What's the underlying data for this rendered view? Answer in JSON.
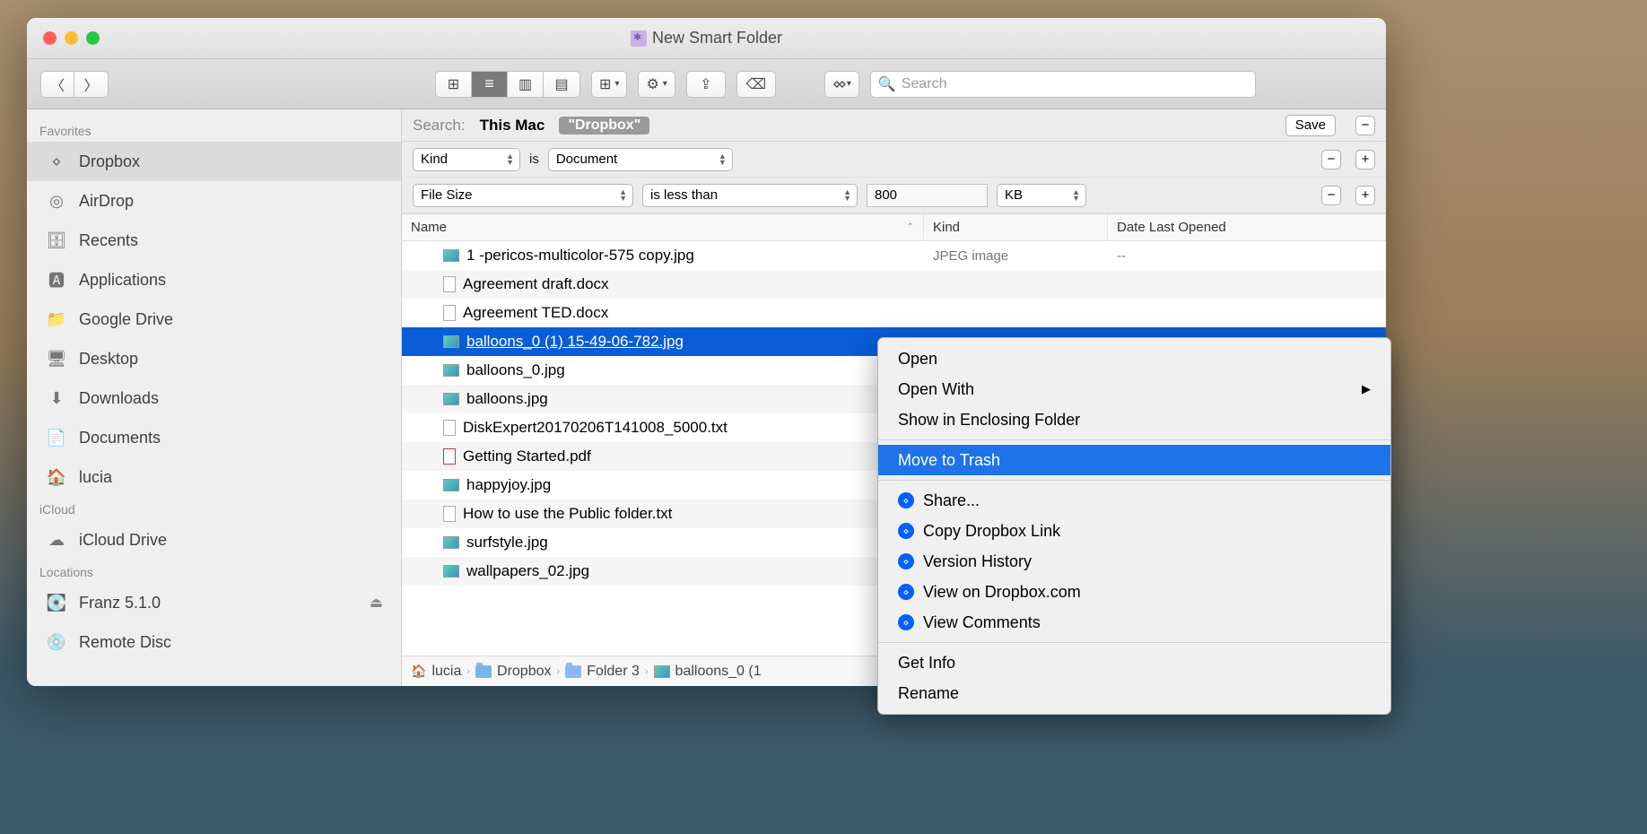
{
  "window": {
    "title": "New Smart Folder"
  },
  "toolbar": {
    "group_label": "Group",
    "action_label": "Action",
    "share_label": "Share",
    "tags_label": "Tags",
    "dropbox_label": "Dropbox",
    "search_placeholder": "Search"
  },
  "sidebar": {
    "favorites_header": "Favorites",
    "favorites": [
      {
        "icon": "dropbox",
        "label": "Dropbox",
        "selected": true
      },
      {
        "icon": "airdrop",
        "label": "AirDrop"
      },
      {
        "icon": "recents",
        "label": "Recents"
      },
      {
        "icon": "apps",
        "label": "Applications"
      },
      {
        "icon": "folder",
        "label": "Google Drive"
      },
      {
        "icon": "desktop",
        "label": "Desktop"
      },
      {
        "icon": "downloads",
        "label": "Downloads"
      },
      {
        "icon": "documents",
        "label": "Documents"
      },
      {
        "icon": "home",
        "label": "lucia"
      }
    ],
    "icloud_header": "iCloud",
    "icloud": [
      {
        "icon": "cloud",
        "label": "iCloud Drive"
      }
    ],
    "locations_header": "Locations",
    "locations": [
      {
        "icon": "disk",
        "label": "Franz 5.1.0",
        "eject": true
      },
      {
        "icon": "disc",
        "label": "Remote Disc"
      }
    ]
  },
  "scope": {
    "label": "Search:",
    "this_mac": "This Mac",
    "dropbox_quoted": "\"Dropbox\"",
    "save": "Save"
  },
  "rules": [
    {
      "attr": "Kind",
      "rel": "is",
      "value": "Document",
      "type": "popup"
    },
    {
      "attr": "File Size",
      "rel": "is less than",
      "value": "800",
      "unit": "KB",
      "type": "num"
    }
  ],
  "columns": {
    "name": "Name",
    "kind": "Kind",
    "date": "Date Last Opened"
  },
  "files": [
    {
      "name": "1 -pericos-multicolor-575 copy.jpg",
      "kind": "JPEG image",
      "date": "--",
      "icon": "img"
    },
    {
      "name": "Agreement draft.docx",
      "kind": "",
      "date": "",
      "icon": "doc"
    },
    {
      "name": "Agreement TED.docx",
      "kind": "",
      "date": "",
      "icon": "doc"
    },
    {
      "name": "balloons_0 (1) 15-49-06-782.jpg",
      "kind": "",
      "date": "",
      "icon": "img",
      "selected": true
    },
    {
      "name": "balloons_0.jpg",
      "kind": "",
      "date": "",
      "icon": "img"
    },
    {
      "name": "balloons.jpg",
      "kind": "",
      "date": "",
      "icon": "img"
    },
    {
      "name": "DiskExpert20170206T141008_5000.txt",
      "kind": "",
      "date": "",
      "icon": "doc"
    },
    {
      "name": "Getting Started.pdf",
      "kind": "",
      "date": "",
      "icon": "pdf"
    },
    {
      "name": "happyjoy.jpg",
      "kind": "",
      "date": "",
      "icon": "img"
    },
    {
      "name": "How to use the Public folder.txt",
      "kind": "",
      "date": "",
      "icon": "doc"
    },
    {
      "name": "surfstyle.jpg",
      "kind": "",
      "date": "",
      "icon": "img"
    },
    {
      "name": "wallpapers_02.jpg",
      "kind": "",
      "date": "",
      "icon": "img"
    }
  ],
  "path": [
    "lucia",
    "Dropbox",
    "Folder 3",
    "balloons_0 (1"
  ],
  "context_menu": {
    "open": "Open",
    "open_with": "Open With",
    "show_enclosing": "Show in Enclosing Folder",
    "trash": "Move to Trash",
    "share": "Share...",
    "copy_link": "Copy Dropbox Link",
    "version": "Version History",
    "view_web": "View on Dropbox.com",
    "view_comments": "View Comments",
    "get_info": "Get Info",
    "rename": "Rename"
  }
}
